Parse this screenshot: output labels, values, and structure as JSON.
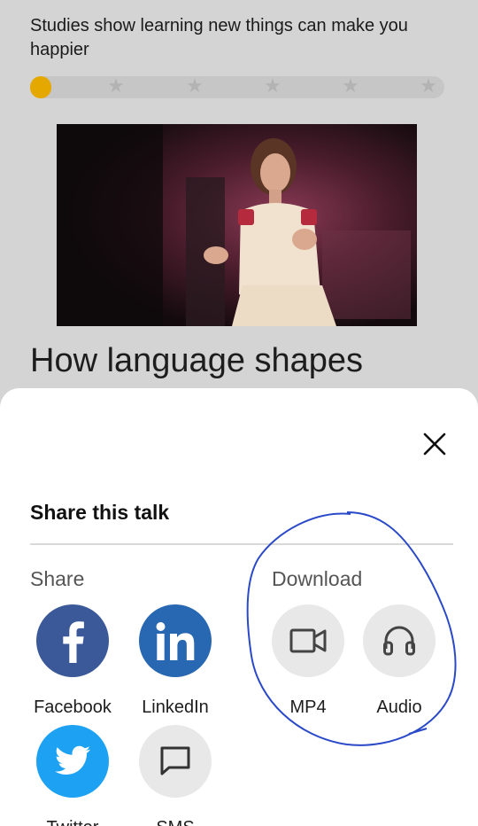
{
  "background": {
    "quiz_text": "Studies show learning new things can make you happier",
    "rating": {
      "selected": 1,
      "total": 6,
      "accent": "#e5a800",
      "star_icon": "★"
    },
    "talk_title": "How language shapes"
  },
  "sheet": {
    "title": "Share this talk",
    "share": {
      "heading": "Share",
      "options": [
        {
          "label": "Facebook",
          "icon": "facebook-icon",
          "color": "#3b5998"
        },
        {
          "label": "LinkedIn",
          "icon": "linkedin-icon",
          "color": "#2867b2"
        },
        {
          "label": "Twitter",
          "icon": "twitter-icon",
          "color": "#1da1f2"
        },
        {
          "label": "SMS",
          "icon": "sms-icon",
          "color": "#e8e8e8"
        }
      ]
    },
    "download": {
      "heading": "Download",
      "options": [
        {
          "label": "MP4",
          "icon": "video-camera-icon",
          "color": "#e8e8e8"
        },
        {
          "label": "Audio",
          "icon": "headphones-icon",
          "color": "#e8e8e8"
        }
      ]
    }
  }
}
